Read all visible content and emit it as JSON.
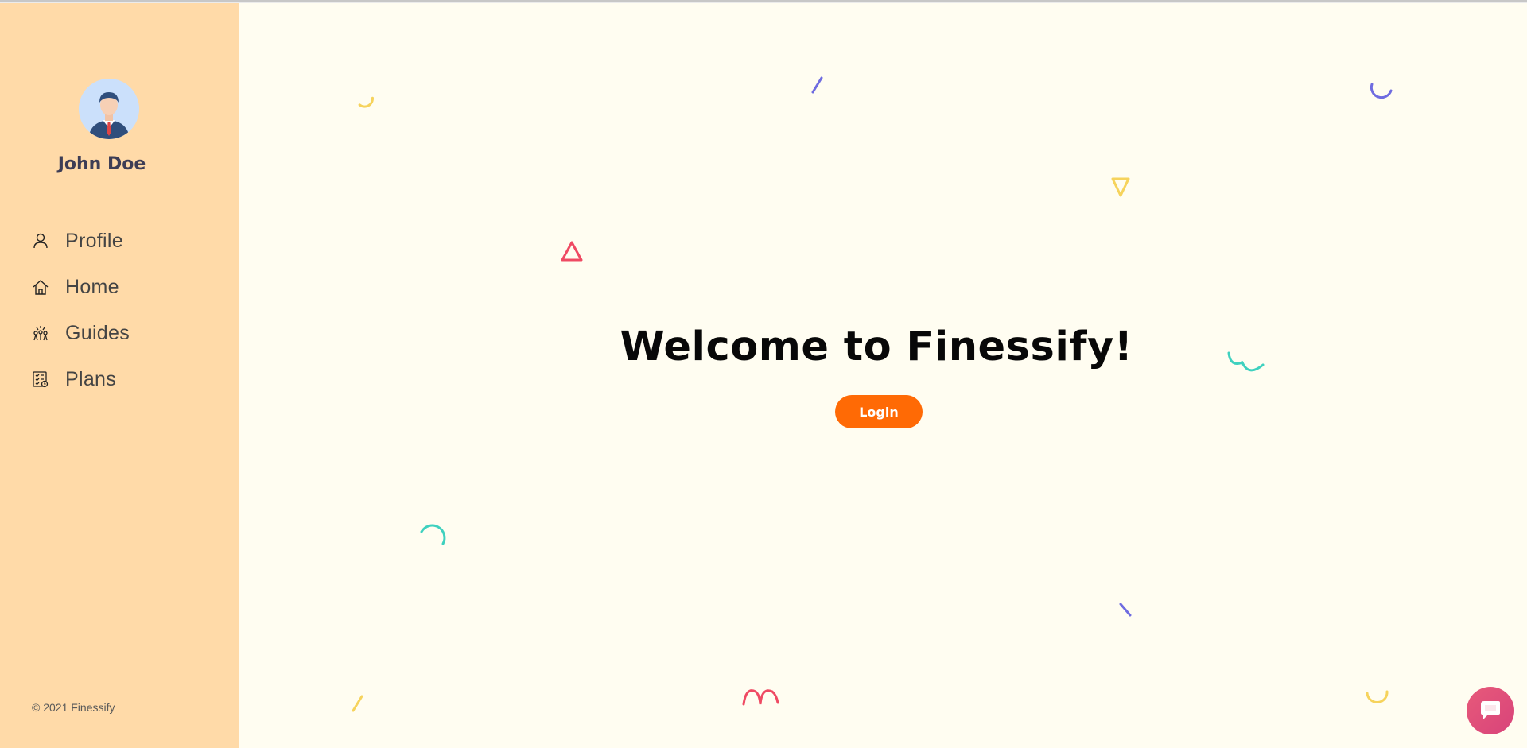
{
  "user": {
    "name": "John Doe"
  },
  "nav": {
    "items": [
      {
        "label": "Profile",
        "icon": "user-icon"
      },
      {
        "label": "Home",
        "icon": "home-icon"
      },
      {
        "label": "Guides",
        "icon": "fireworks-icon"
      },
      {
        "label": "Plans",
        "icon": "checklist-icon"
      }
    ]
  },
  "footer": {
    "copyright": "© 2021 Finessify"
  },
  "main": {
    "title": "Welcome to Finessify!",
    "login_label": "Login"
  },
  "chat": {
    "icon": "chat-bubble-icon"
  },
  "colors": {
    "sidebar_bg": "#ffdaa8",
    "main_bg": "#fffdf1",
    "accent": "#ff6a05",
    "chat": "#e0507a",
    "deco_yellow": "#f6d35c",
    "deco_purple": "#6f6ce0",
    "deco_red": "#ef4a63",
    "deco_teal": "#3fd1bf"
  }
}
